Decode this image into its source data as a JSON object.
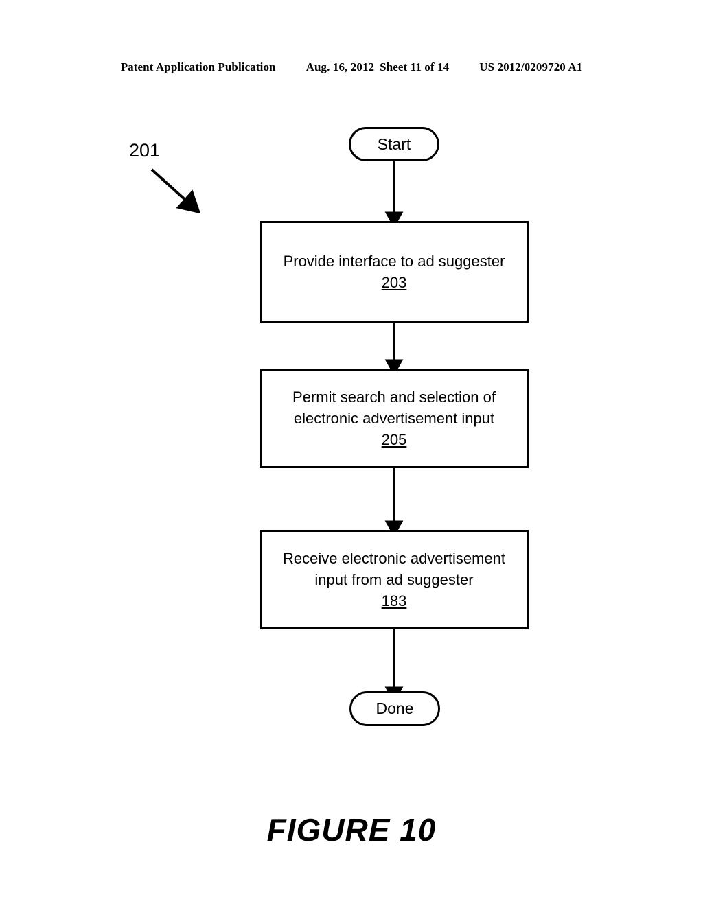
{
  "header": {
    "publication": "Patent Application Publication",
    "date": "Aug. 16, 2012",
    "sheet": "Sheet 11 of 14",
    "number": "US 2012/0209720 A1"
  },
  "figure": {
    "caption": "FIGURE 10",
    "diagram_reference": "201"
  },
  "flowchart": {
    "start": {
      "label": "Start"
    },
    "steps": [
      {
        "text": "Provide interface to ad suggester",
        "ref": "203"
      },
      {
        "text": "Permit search and selection of electronic advertisement input",
        "ref": "205"
      },
      {
        "text": "Receive electronic advertisement input from ad suggester",
        "ref": "183"
      }
    ],
    "end": {
      "label": "Done"
    }
  },
  "colors": {
    "ink": "#000000",
    "paper": "#ffffff"
  }
}
